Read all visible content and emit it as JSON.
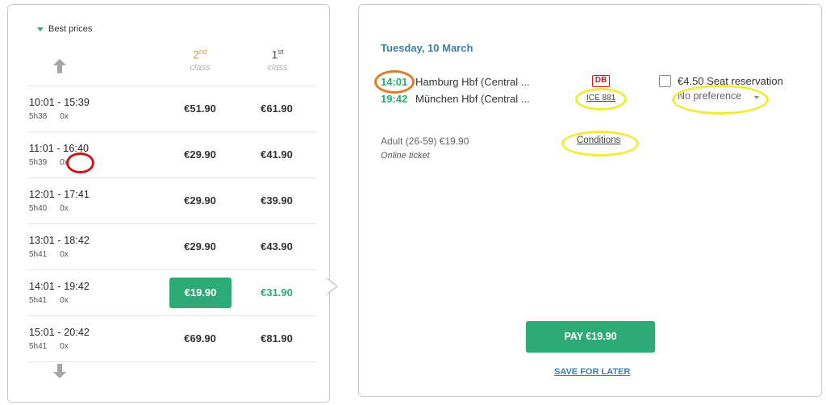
{
  "left": {
    "best_prices_label": "Best prices",
    "col_2": {
      "num": "2",
      "sup": "nd",
      "cls": "class"
    },
    "col_1": {
      "num": "1",
      "sup": "st",
      "cls": "class"
    },
    "rows": [
      {
        "times": "10:01  -  15:39",
        "duration": "5h38",
        "changes": "0x",
        "p2": "€51.90",
        "p1": "€61.90",
        "selected": false
      },
      {
        "times": "11:01  -  16:40",
        "duration": "5h39",
        "changes": "0x",
        "p2": "€29.90",
        "p1": "€41.90",
        "selected": false
      },
      {
        "times": "12:01  -  17:41",
        "duration": "5h40",
        "changes": "0x",
        "p2": "€29.90",
        "p1": "€39.90",
        "selected": false
      },
      {
        "times": "13:01  -  18:42",
        "duration": "5h41",
        "changes": "0x",
        "p2": "€29.90",
        "p1": "€43.90",
        "selected": false
      },
      {
        "times": "14:01  -  19:42",
        "duration": "5h41",
        "changes": "0x",
        "p2": "€19.90",
        "p1": "€31.90",
        "selected": true
      },
      {
        "times": "15:01  -  20:42",
        "duration": "5h41",
        "changes": "0x",
        "p2": "€69.90",
        "p1": "€81.90",
        "selected": false
      }
    ]
  },
  "right": {
    "date": "Tuesday, 10 March",
    "departure_time": "14:01",
    "departure_station": "Hamburg Hbf (Central ...",
    "arrival_time": "19:42",
    "arrival_station": "München Hbf (Central ...",
    "operator_logo": "DB",
    "train_number": "ICE 881",
    "seat_reservation": "€4.50 Seat reservation",
    "seat_preference": "No preference",
    "fare": "Adult (26-59) €19.90",
    "ticket_type": "Online ticket",
    "conditions": "Conditions",
    "pay_button": "PAY €19.90",
    "save_later": "SAVE FOR LATER"
  },
  "colors": {
    "accent_green": "#2eaa77",
    "accent_blue": "#3f7fa6",
    "second_class": "#d09a45",
    "annotation_red": "#c41a1a",
    "annotation_orange": "#e07b26",
    "annotation_yellow": "#f1eb3a"
  }
}
